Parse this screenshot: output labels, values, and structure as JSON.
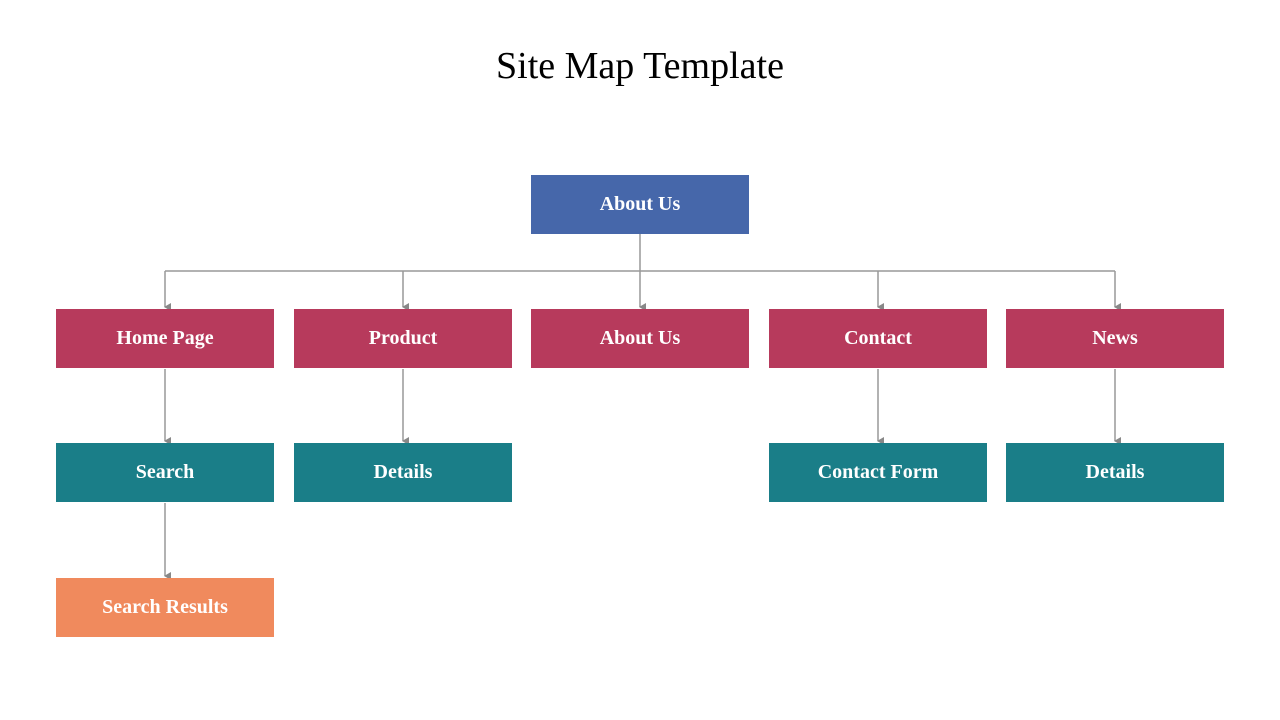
{
  "title": "Site Map Template",
  "colors": {
    "root": "#4667AA",
    "level1": "#B73A5C",
    "level2": "#1A7E88",
    "level3": "#F08A5D",
    "connector": "#888888"
  },
  "nodes": {
    "root": "About Us",
    "level1": [
      "Home Page",
      "Product",
      "About Us",
      "Contact",
      "News"
    ],
    "level2": {
      "home": "Search",
      "product": "Details",
      "contact": "Contact Form",
      "news": "Details"
    },
    "level3": {
      "search": "Search Results"
    }
  }
}
